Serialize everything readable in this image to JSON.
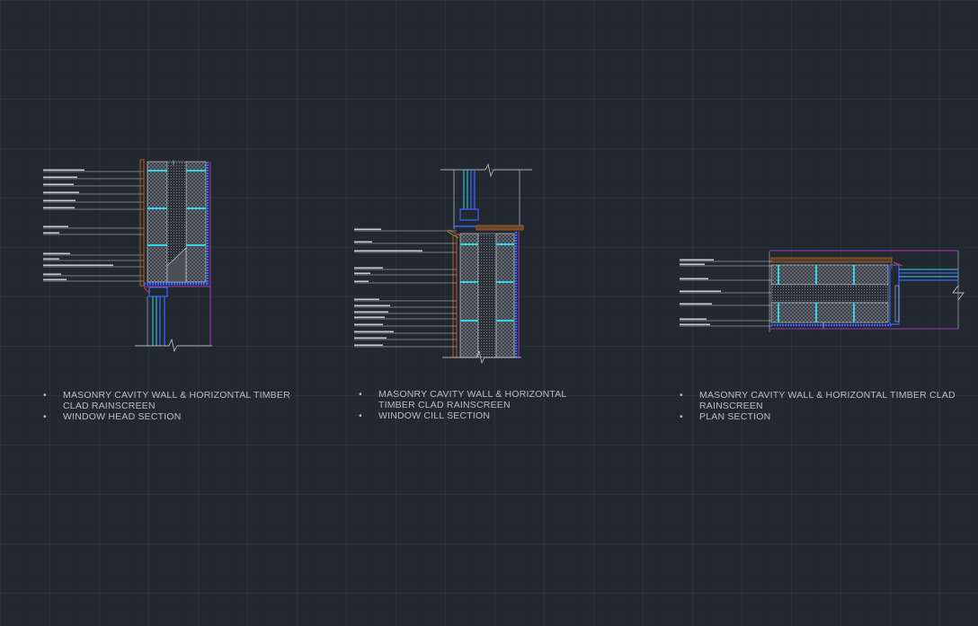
{
  "drawings": [
    {
      "id": "head",
      "caption_lines": [
        "MASONRY CAVITY WALL &  HORIZONTAL TIMBER CLAD RAINSCREEN",
        "WINDOW HEAD SECTION"
      ]
    },
    {
      "id": "cill",
      "caption_lines": [
        "MASONRY CAVITY WALL & HORIZONTAL TIMBER CLAD RAINSCREEN",
        "WINDOW CILL SECTION"
      ]
    },
    {
      "id": "plan",
      "caption_lines": [
        "MASONRY CAVITY WALL & HORIZONTAL TIMBER CLAD RAINSCREEN",
        "PLAN SECTION"
      ]
    }
  ],
  "colors": {
    "background": "#212830",
    "grid_minor": "#2a313a",
    "grid_major": "#333b46",
    "line_white": "#d9dde2",
    "cyan": "#33d6e6",
    "blue": "#3b63ff",
    "magenta": "#d23bd8",
    "red": "#e03a3a",
    "green": "#3bd84a",
    "brown": "#b0602a",
    "hatch": "#9aa0a8"
  }
}
